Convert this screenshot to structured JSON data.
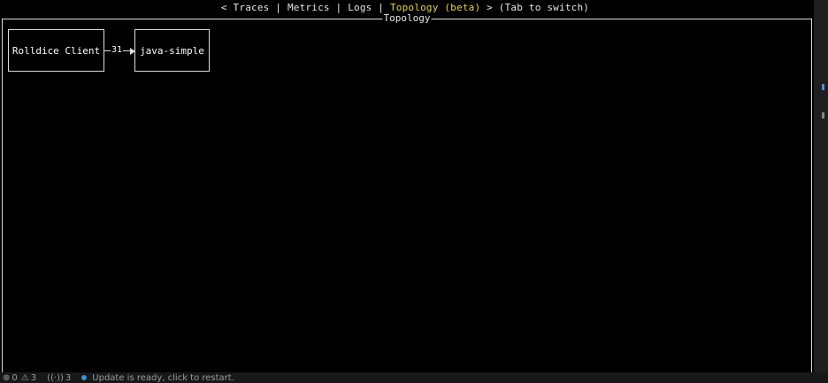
{
  "tabs": {
    "prefix": "< ",
    "items": [
      {
        "label": "Traces",
        "active": false
      },
      {
        "label": "Metrics",
        "active": false
      },
      {
        "label": "Logs",
        "active": false
      },
      {
        "label": "Topology (beta)",
        "active": true
      }
    ],
    "separator": " | ",
    "suffix": " > (Tab to switch)"
  },
  "panel": {
    "title": "Topology"
  },
  "topology": {
    "nodes": [
      {
        "label": "Rolldice Client"
      },
      {
        "label": "java-simple"
      }
    ],
    "edges": [
      {
        "from": "Rolldice Client",
        "to": "java-simple",
        "label": "31"
      }
    ]
  },
  "statusbar": {
    "errors_icon": "error-circle-icon",
    "errors": "0",
    "warnings_icon": "warning-triangle-icon",
    "warnings": "3",
    "ports_icon": "broadcast-icon",
    "ports": "3",
    "update_message": "Update is ready, click to restart."
  },
  "colors": {
    "background": "#000000",
    "text": "#e6e6e6",
    "active_tab": "#e6d44a",
    "border": "#dcdcdc",
    "status_dot": "#3b8fd6"
  }
}
